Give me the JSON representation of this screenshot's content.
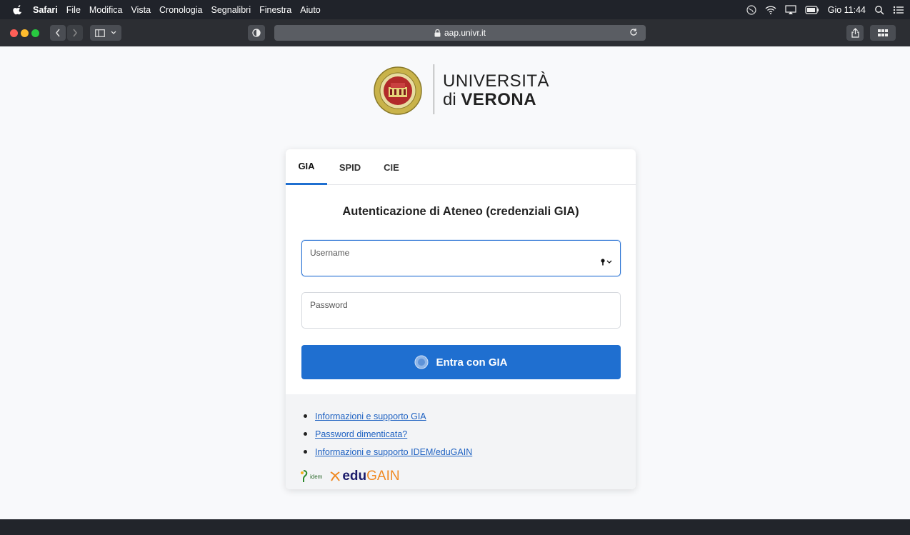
{
  "menubar": {
    "app": "Safari",
    "items": [
      "File",
      "Modifica",
      "Vista",
      "Cronologia",
      "Segnalibri",
      "Finestra",
      "Aiuto"
    ],
    "clock": "Gio 11:44"
  },
  "browser": {
    "url": "aap.univr.it"
  },
  "logo": {
    "line1": "UNIVERSITÀ",
    "line2_prefix": "di",
    "line2_bold": "VERONA"
  },
  "tabs": [
    {
      "label": "GIA",
      "active": true
    },
    {
      "label": "SPID",
      "active": false
    },
    {
      "label": "CIE",
      "active": false
    }
  ],
  "form": {
    "title": "Autenticazione di Ateneo (credenziali GIA)",
    "username_label": "Username",
    "username_value": "",
    "password_label": "Password",
    "password_value": "",
    "submit_label": "Entra con GIA"
  },
  "links": [
    "Informazioni e supporto GIA",
    "Password dimenticata?",
    "Informazioni e supporto IDEM/eduGAIN"
  ],
  "federation_logos": {
    "idem": "idem",
    "edugain_prefix": "edu",
    "edugain_suffix": "GAIN"
  },
  "colors": {
    "primary": "#1f6fd0",
    "link": "#1f62c2",
    "menubar": "#20232a",
    "toolbar": "#2c2e33"
  }
}
